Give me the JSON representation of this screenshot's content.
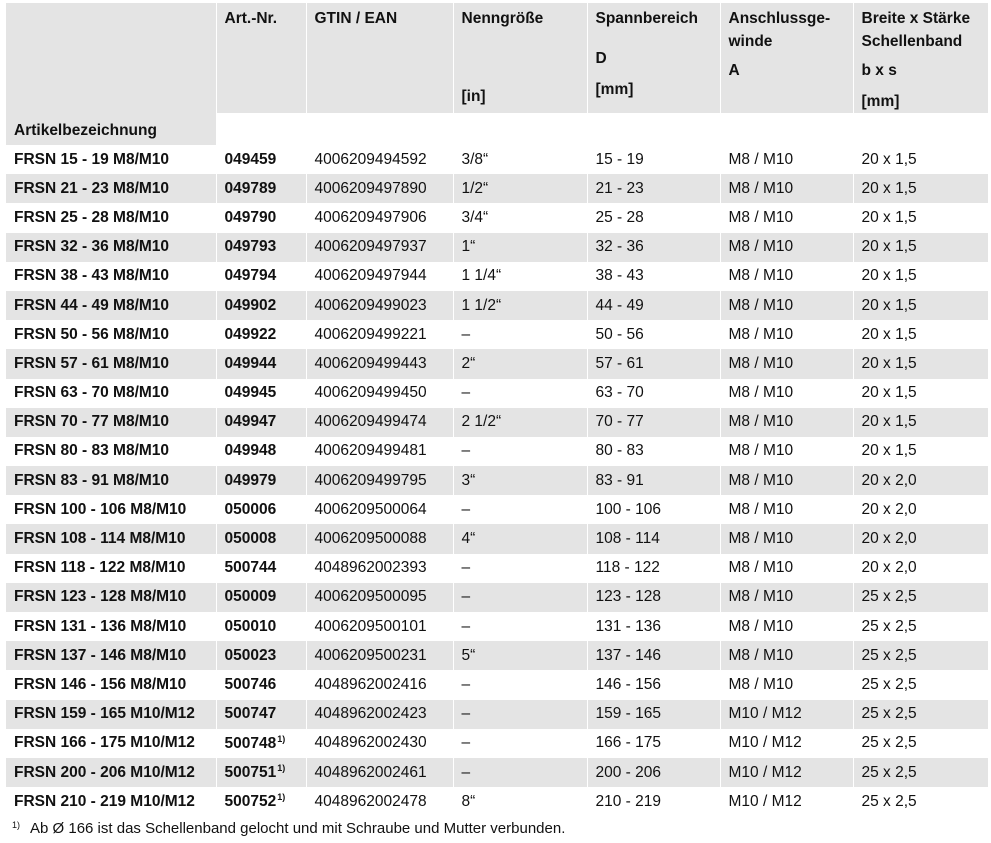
{
  "headers": {
    "art_nr": "Art.-Nr.",
    "gtin": "GTIN / EAN",
    "nenn": "Nenngröße",
    "nenn_unit": "[in]",
    "spann": "Spannbereich",
    "spann_sym": "D",
    "spann_unit": "[mm]",
    "anschl_line1": "Anschlussge-",
    "anschl_line2": "winde",
    "anschl_sym": "A",
    "breite_line1": "Breite x Stärke",
    "breite_line2": "Schellenband",
    "breite_sym": "b x s",
    "breite_unit": "[mm]",
    "artikel": "Artikelbezeichnung"
  },
  "rows": [
    {
      "name": "FRSN 15 - 19 M8/M10",
      "art": "049459",
      "fn": "",
      "gtin": "4006209494592",
      "nenn": "3/8“",
      "spann": "15 - 19",
      "gewinde": "M8 / M10",
      "band": "20 x 1,5"
    },
    {
      "name": "FRSN 21 - 23 M8/M10",
      "art": "049789",
      "fn": "",
      "gtin": "4006209497890",
      "nenn": "1/2“",
      "spann": "21 - 23",
      "gewinde": "M8 / M10",
      "band": "20 x 1,5"
    },
    {
      "name": "FRSN 25 - 28 M8/M10",
      "art": "049790",
      "fn": "",
      "gtin": "4006209497906",
      "nenn": "3/4“",
      "spann": "25 - 28",
      "gewinde": "M8 / M10",
      "band": "20 x 1,5"
    },
    {
      "name": "FRSN 32 - 36 M8/M10",
      "art": "049793",
      "fn": "",
      "gtin": "4006209497937",
      "nenn": "1“",
      "spann": "32 - 36",
      "gewinde": "M8 / M10",
      "band": "20 x 1,5"
    },
    {
      "name": "FRSN 38 - 43 M8/M10",
      "art": "049794",
      "fn": "",
      "gtin": "4006209497944",
      "nenn": "1 1/4“",
      "spann": "38 - 43",
      "gewinde": "M8 / M10",
      "band": "20 x 1,5"
    },
    {
      "name": "FRSN 44 - 49 M8/M10",
      "art": "049902",
      "fn": "",
      "gtin": "4006209499023",
      "nenn": "1 1/2“",
      "spann": "44 - 49",
      "gewinde": "M8 / M10",
      "band": "20 x 1,5"
    },
    {
      "name": "FRSN 50 - 56 M8/M10",
      "art": "049922",
      "fn": "",
      "gtin": "4006209499221",
      "nenn": "–",
      "spann": "50 - 56",
      "gewinde": "M8 / M10",
      "band": "20 x 1,5"
    },
    {
      "name": "FRSN 57 - 61 M8/M10",
      "art": "049944",
      "fn": "",
      "gtin": "4006209499443",
      "nenn": "2“",
      "spann": "57 - 61",
      "gewinde": "M8 / M10",
      "band": "20 x 1,5"
    },
    {
      "name": "FRSN 63 - 70 M8/M10",
      "art": "049945",
      "fn": "",
      "gtin": "4006209499450",
      "nenn": "–",
      "spann": "63 - 70",
      "gewinde": "M8 / M10",
      "band": "20 x 1,5"
    },
    {
      "name": "FRSN 70 - 77 M8/M10",
      "art": "049947",
      "fn": "",
      "gtin": "4006209499474",
      "nenn": "2 1/2“",
      "spann": "70 - 77",
      "gewinde": "M8 / M10",
      "band": "20 x 1,5"
    },
    {
      "name": "FRSN 80 - 83 M8/M10",
      "art": "049948",
      "fn": "",
      "gtin": "4006209499481",
      "nenn": "–",
      "spann": "80 - 83",
      "gewinde": "M8 / M10",
      "band": "20 x 1,5"
    },
    {
      "name": "FRSN 83 - 91 M8/M10",
      "art": "049979",
      "fn": "",
      "gtin": "4006209499795",
      "nenn": "3“",
      "spann": "83 - 91",
      "gewinde": "M8 / M10",
      "band": "20 x 2,0"
    },
    {
      "name": "FRSN 100 - 106 M8/M10",
      "art": "050006",
      "fn": "",
      "gtin": "4006209500064",
      "nenn": "–",
      "spann": "100 - 106",
      "gewinde": "M8 / M10",
      "band": "20 x 2,0"
    },
    {
      "name": "FRSN 108 - 114 M8/M10",
      "art": "050008",
      "fn": "",
      "gtin": "4006209500088",
      "nenn": "4“",
      "spann": "108 - 114",
      "gewinde": "M8 / M10",
      "band": "20 x 2,0"
    },
    {
      "name": "FRSN 118 - 122 M8/M10",
      "art": "500744",
      "fn": "",
      "gtin": "4048962002393",
      "nenn": "–",
      "spann": "118 - 122",
      "gewinde": "M8 / M10",
      "band": "20 x 2,0"
    },
    {
      "name": "FRSN 123 - 128 M8/M10",
      "art": "050009",
      "fn": "",
      "gtin": "4006209500095",
      "nenn": "–",
      "spann": "123 - 128",
      "gewinde": "M8 / M10",
      "band": "25 x 2,5"
    },
    {
      "name": "FRSN 131 - 136 M8/M10",
      "art": "050010",
      "fn": "",
      "gtin": "4006209500101",
      "nenn": "–",
      "spann": "131 - 136",
      "gewinde": "M8 / M10",
      "band": "25 x 2,5"
    },
    {
      "name": "FRSN 137 - 146 M8/M10",
      "art": "050023",
      "fn": "",
      "gtin": "4006209500231",
      "nenn": "5“",
      "spann": "137 - 146",
      "gewinde": "M8 / M10",
      "band": "25 x 2,5"
    },
    {
      "name": "FRSN 146 - 156 M8/M10",
      "art": "500746",
      "fn": "",
      "gtin": "4048962002416",
      "nenn": "–",
      "spann": "146 - 156",
      "gewinde": "M8 / M10",
      "band": "25 x 2,5"
    },
    {
      "name": "FRSN 159 - 165 M10/M12",
      "art": "500747",
      "fn": "",
      "gtin": "4048962002423",
      "nenn": "–",
      "spann": "159 - 165",
      "gewinde": "M10 / M12",
      "band": "25 x 2,5"
    },
    {
      "name": "FRSN 166 - 175 M10/M12",
      "art": "500748",
      "fn": "1)",
      "gtin": "4048962002430",
      "nenn": "–",
      "spann": "166 - 175",
      "gewinde": "M10 / M12",
      "band": "25 x 2,5"
    },
    {
      "name": "FRSN 200 - 206 M10/M12",
      "art": "500751",
      "fn": "1)",
      "gtin": "4048962002461",
      "nenn": "–",
      "spann": "200 - 206",
      "gewinde": "M10 / M12",
      "band": "25 x 2,5"
    },
    {
      "name": "FRSN 210 - 219 M10/M12",
      "art": "500752",
      "fn": "1)",
      "gtin": "4048962002478",
      "nenn": "8“",
      "spann": "210 - 219",
      "gewinde": "M10 / M12",
      "band": "25 x 2,5"
    }
  ],
  "footnote": {
    "marker": "1)",
    "text": "Ab Ø 166 ist das Schellenband gelocht und mit Schraube und Mutter verbunden."
  },
  "colors": {
    "stripe": "#e4e4e4",
    "accent_line": "#d2232a"
  }
}
